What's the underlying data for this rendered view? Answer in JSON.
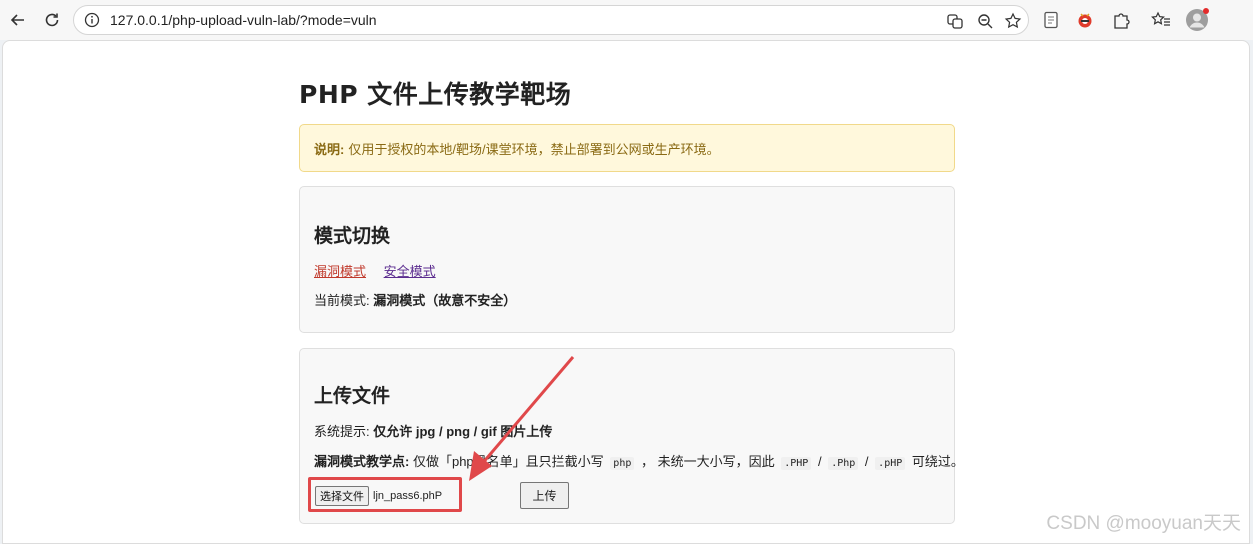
{
  "browser": {
    "url": "127.0.0.1/php-upload-vuln-lab/?mode=vuln",
    "icons": [
      "back-icon",
      "reload-icon",
      "info-icon",
      "translate-icon",
      "zoom-icon",
      "favorite-icon",
      "reading-icon",
      "extension-icon",
      "puzzle-icon",
      "favorites-bar-icon",
      "profile-icon"
    ]
  },
  "page": {
    "title": "PHP 文件上传教学靶场",
    "notice": {
      "label": "说明:",
      "text": "仅用于授权的本地/靶场/课堂环境，禁止部署到公网或生产环境。"
    },
    "mode_card": {
      "heading": "模式切换",
      "vuln_link": "漏洞模式",
      "safe_link": "安全模式",
      "current_label": "当前模式:",
      "current_value": "漏洞模式（故意不安全）"
    },
    "upload_card": {
      "heading": "上传文件",
      "hint_label": "系统提示:",
      "hint_value": "仅允许 jpg / png / gif 图片上传",
      "teach_label": "漏洞模式教学点:",
      "teach_text_1": "仅做「php黑名单」且只拦截小写",
      "teach_code_1": "php",
      "teach_text_2": "， 未统一大小写，因此",
      "teach_code_2": ".PHP",
      "teach_sep_1": "/",
      "teach_code_3": ".Php",
      "teach_sep_2": "/",
      "teach_code_4": ".pHP",
      "teach_text_3": "可绕过。",
      "choose_file_label": "选择文件",
      "chosen_file": "ljn_pass6.phP",
      "upload_button": "上传"
    }
  },
  "watermark": "CSDN @mooyuan天天",
  "colors": {
    "annotation_red": "#e0484a",
    "vuln_link": "#c0392b",
    "safe_link": "#5b2c8f"
  }
}
